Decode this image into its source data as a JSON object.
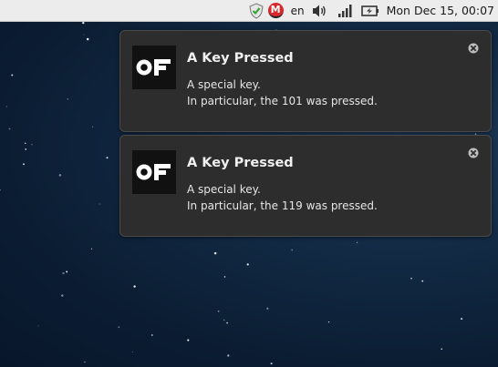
{
  "panel": {
    "tray": [
      {
        "icon": "shield-check-icon"
      },
      {
        "icon": "mega-icon",
        "label": "M",
        "color": "#d9272e"
      },
      {
        "icon": "volume-icon"
      },
      {
        "icon": "network-signal-icon"
      },
      {
        "icon": "battery-charging-icon"
      }
    ],
    "keyboard_layout": "en",
    "clock": "Mon Dec 15, 00:07"
  },
  "notifications": [
    {
      "app_icon": "openframeworks-logo-icon",
      "summary": "A Key Pressed",
      "body_line1": "A special key.",
      "body_line2": "In particular, the 101 was pressed."
    },
    {
      "app_icon": "openframeworks-logo-icon",
      "summary": "A Key Pressed",
      "body_line1": "A special key.",
      "body_line2": "In particular, the 119 was pressed."
    }
  ],
  "colors": {
    "panel_bg": "#ececec",
    "notification_bg": "#2d2d2d",
    "desktop_bg": "#0b1d33"
  }
}
